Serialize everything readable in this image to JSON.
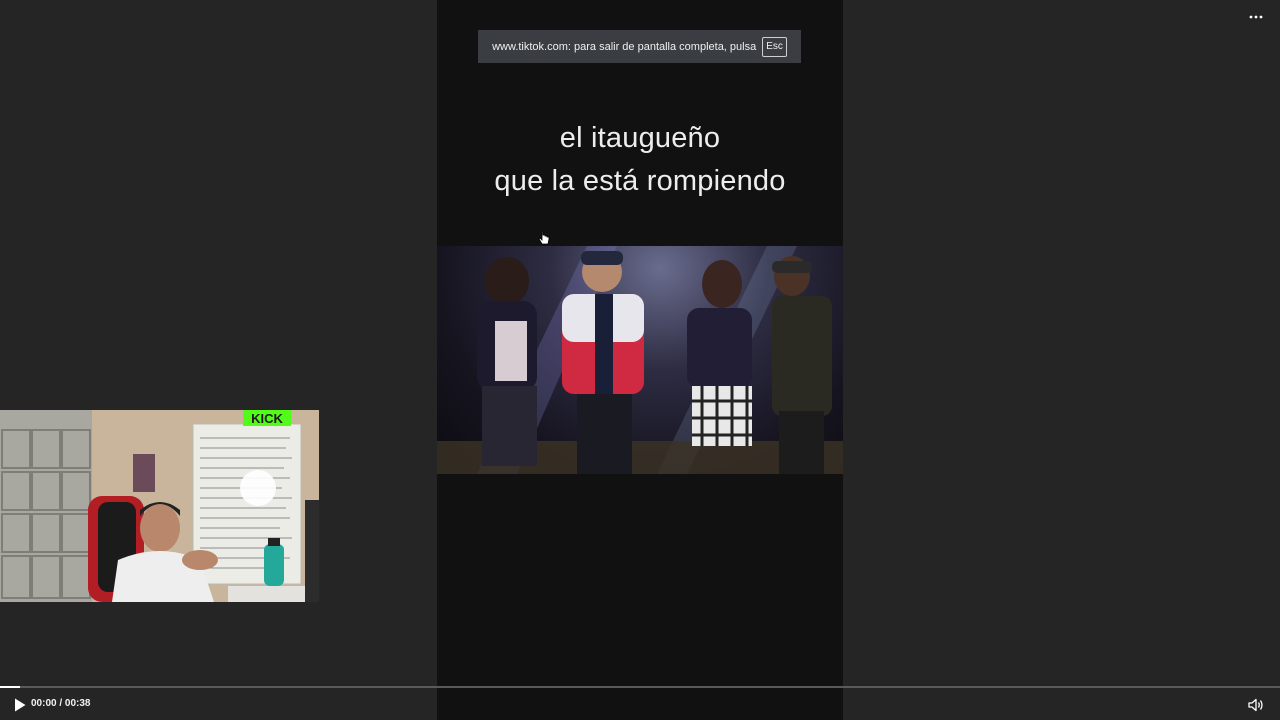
{
  "fullscreen_notice": {
    "text": "www.tiktok.com: para salir de pantalla completa, pulsa",
    "key": "Esc"
  },
  "caption": {
    "line1": "el itaugueño",
    "line2": "que la está rompiendo"
  },
  "webcam": {
    "banner": "KICK"
  },
  "player": {
    "current_time": "00:00",
    "separator": " / ",
    "duration": "00:38",
    "progress": 0.016
  },
  "icons": {
    "play": "play-icon",
    "volume": "volume-icon",
    "more": "more-options-icon",
    "cursor": "hand-pointer-icon"
  }
}
